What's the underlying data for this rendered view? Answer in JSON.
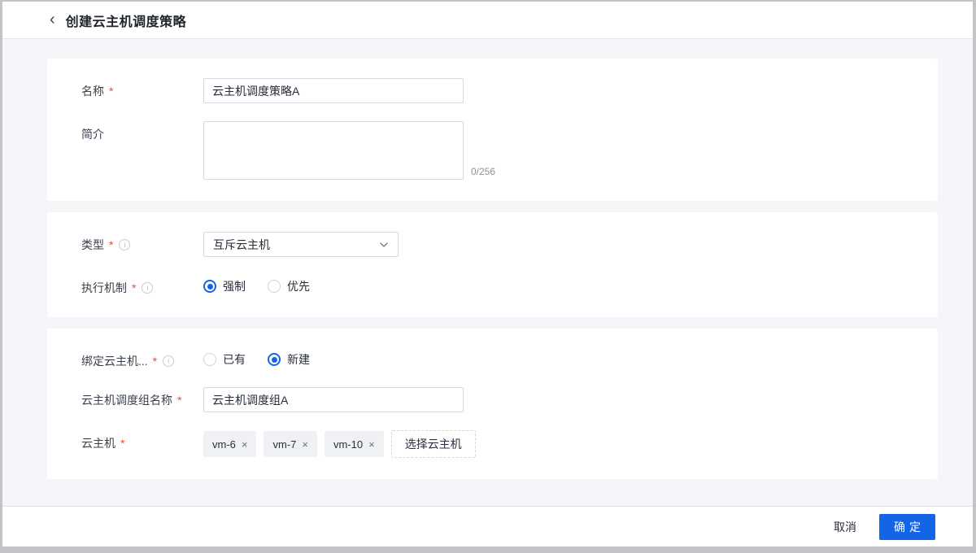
{
  "icons": {
    "back": "‹",
    "info": "i",
    "close": "×"
  },
  "colors": {
    "accent": "#1465e6",
    "background": "#f4f6f9"
  },
  "header": {
    "title": "创建云主机调度策略"
  },
  "basic": {
    "name": {
      "label": "名称",
      "required": "*",
      "value": "云主机调度策略A"
    },
    "intro": {
      "label": "简介",
      "value": "",
      "counter": "0/256"
    }
  },
  "policy": {
    "type": {
      "label": "类型",
      "required": "*",
      "value": "互斥云主机"
    },
    "mechanism": {
      "label": "执行机制",
      "required": "*",
      "selected": "强制",
      "options": [
        {
          "label": "强制"
        },
        {
          "label": "优先"
        }
      ]
    }
  },
  "binding": {
    "bind_group": {
      "label": "绑定云主机...",
      "required": "*",
      "selected": "新建",
      "options": [
        {
          "label": "已有"
        },
        {
          "label": "新建"
        }
      ]
    },
    "group_name": {
      "label": "云主机调度组名称",
      "required": "*",
      "value": "云主机调度组A"
    },
    "vms": {
      "label": "云主机",
      "required": "*",
      "tags": [
        "vm-6",
        "vm-7",
        "vm-10"
      ],
      "select_button": "选择云主机"
    }
  },
  "footer": {
    "cancel": "取消",
    "confirm": "确定"
  }
}
